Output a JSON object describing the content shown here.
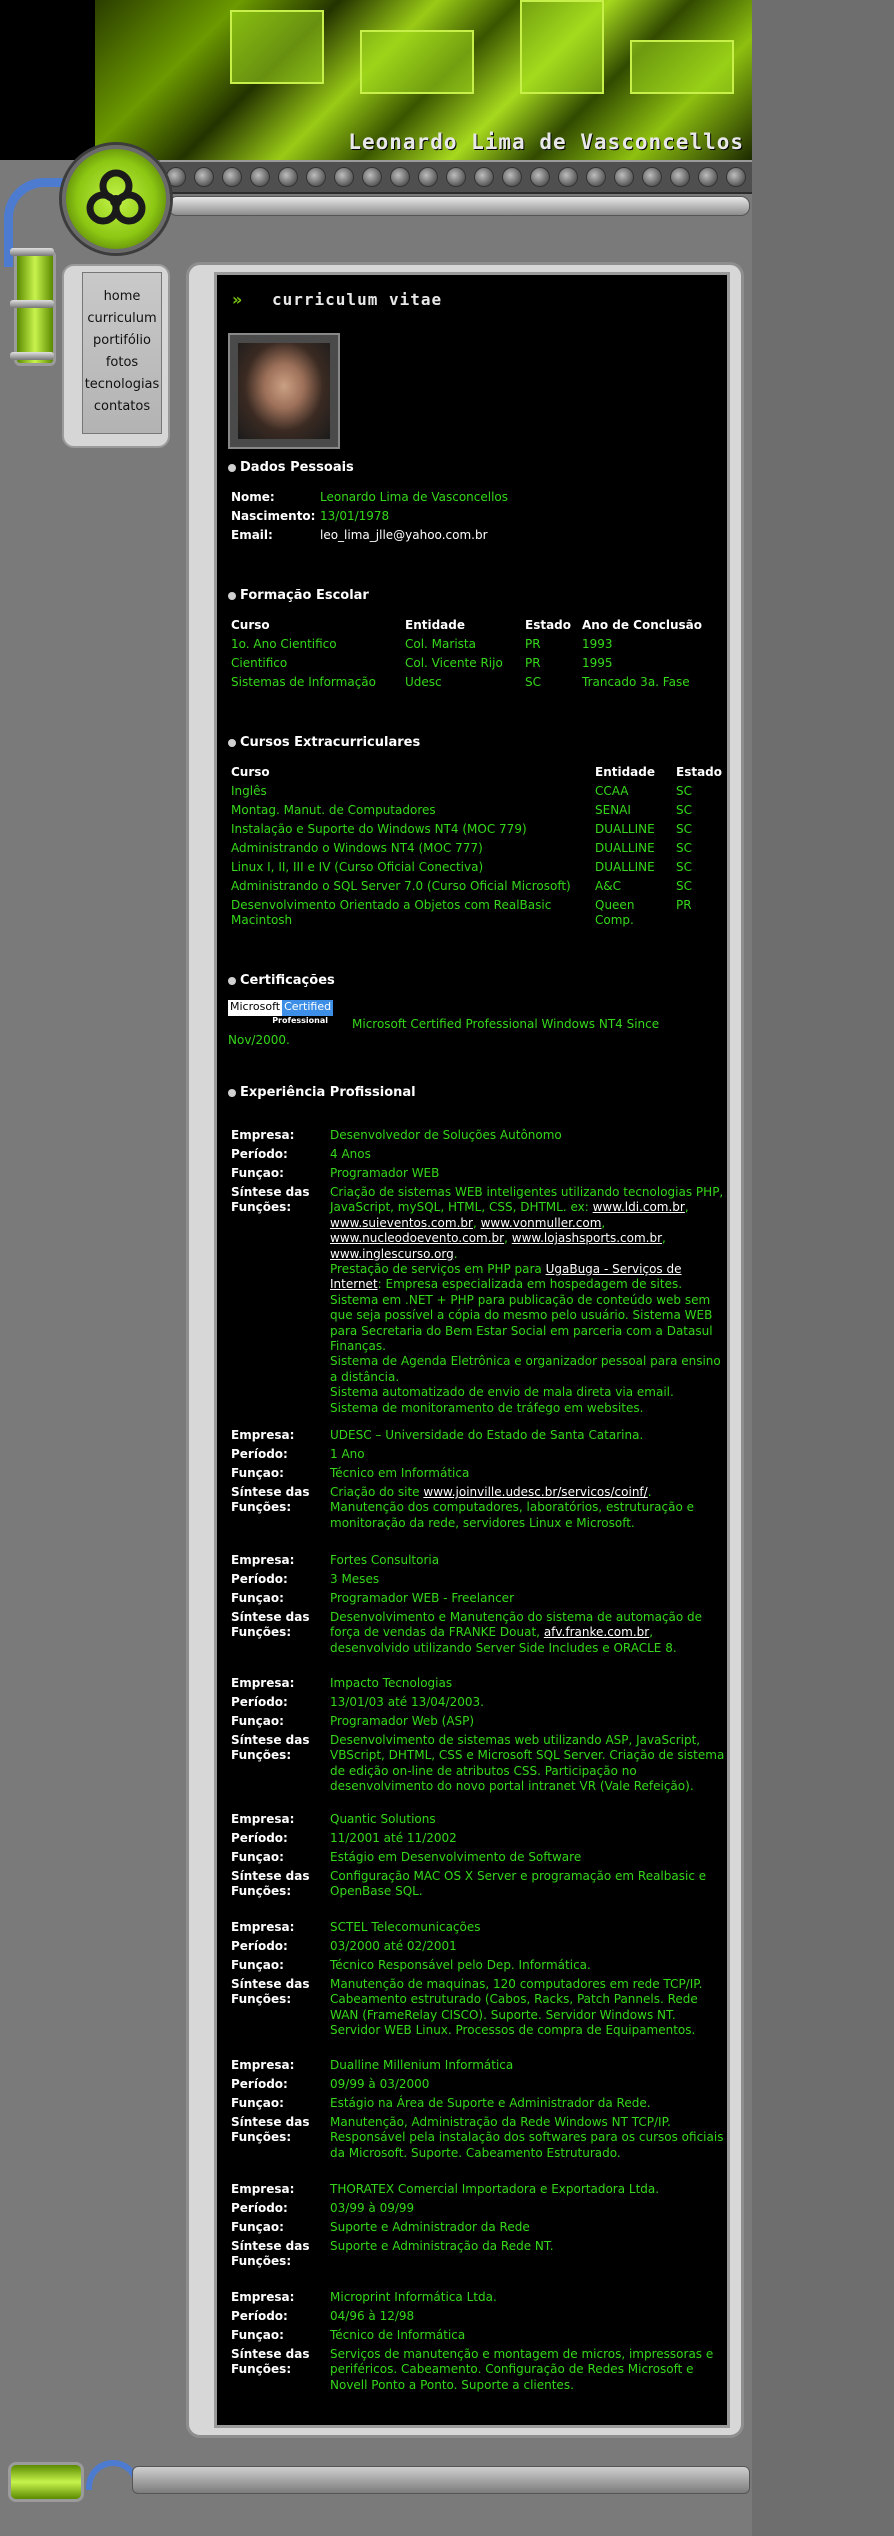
{
  "header": {
    "title": "Leonardo Lima de Vasconcellos"
  },
  "nav": [
    "home",
    "curriculum",
    "portifólio",
    "fotos",
    "tecnologias",
    "contatos"
  ],
  "cv_title": "curriculum vitae",
  "sections": {
    "dados": "Dados Pessoais",
    "formacao": "Formação Escolar",
    "cursos": "Cursos Extracurriculares",
    "certificacoes": "Certificações",
    "experiencia": "Experiência Profissional"
  },
  "personal": {
    "nome_label": "Nome:",
    "nome": "Leonardo Lima de Vasconcellos",
    "nasc_label": "Nascimento:",
    "nasc": "13/01/1978",
    "email_label": "Email:",
    "email": "leo_lima_jlle@yahoo.com.br"
  },
  "formacao": {
    "headers": [
      "Curso",
      "Entidade",
      "Estado",
      "Ano de Conclusão"
    ],
    "rows": [
      [
        "1o. Ano Cientifico",
        "Col. Marista",
        "PR",
        "1993"
      ],
      [
        "Cientifico",
        "Col. Vicente Rijo",
        "PR",
        "1995"
      ],
      [
        "Sistemas de Informação",
        "Udesc",
        "SC",
        "Trancado 3a. Fase"
      ]
    ]
  },
  "cursos": {
    "headers": [
      "Curso",
      "Entidade",
      "Estado"
    ],
    "rows": [
      [
        "Inglês",
        "CCAA",
        "SC"
      ],
      [
        "Montag. Manut. de Computadores",
        "SENAI",
        "SC"
      ],
      [
        "Instalação e Suporte do Windows NT4 (MOC 779)",
        "DUALLINE",
        "SC"
      ],
      [
        "Administrando o Windows NT4 (MOC 777)",
        "DUALLINE",
        "SC"
      ],
      [
        "Linux I, II, III e IV (Curso Oficial Conectiva)",
        "DUALLINE",
        "SC"
      ],
      [
        "Administrando o SQL Server 7.0 (Curso Oficial Microsoft)",
        "A&C",
        "SC"
      ],
      [
        "Desenvolvimento Orientado a Objetos com RealBasic Macintosh",
        "Queen Comp.",
        "PR"
      ]
    ]
  },
  "cert": {
    "logo_a": "Microsoft",
    "logo_b": "Certified",
    "logo_c": "Professional",
    "text": "Microsoft Certified Professional Windows NT4 Since Nov/2000."
  },
  "labels": {
    "empresa": "Empresa:",
    "periodo": "Período:",
    "funcao": "Funçao:",
    "sintese1": "Síntese das",
    "sintese2": "Funções:"
  },
  "jobs": [
    {
      "empresa": "Desenvolvedor de Soluções Autônomo",
      "periodo": "4 Anos",
      "funcao": "Programador WEB",
      "sintese": "Criação de sistemas WEB inteligentes utilizando tecnologias PHP, JavaScript, mySQL, HTML, CSS, DHTML. ex: <a>www.ldi.com.br</a>, <a>www.suieventos.com.br</a>, <a>www.vonmuller.com</a>, <a>www.nucleodoevento.com.br</a>, <a>www.lojashsports.com.br</a>, <a>www.inglescurso.org</a>.<br>Prestação de serviços em PHP para <a>UgaBuga - Serviços de Internet</a>: Empresa especializada em hospedagem de sites.<br>Sistema em .NET + PHP para publicação de conteúdo web sem que seja possível a cópia do mesmo pelo usuário. Sistema WEB para Secretaria do Bem Estar Social em parceria com a Datasul Finanças.<br>Sistema de Agenda Eletrônica e organizador pessoal para ensino a distância.<br>Sistema automatizado de envio de mala direta via email.<br>Sistema de monitoramento de tráfego em websites."
    },
    {
      "empresa": "UDESC – Universidade do Estado de Santa Catarina.",
      "periodo": "1 Ano",
      "funcao": "Técnico em Informática",
      "sintese": "Criação do site <a>www.joinville.udesc.br/servicos/coinf/</a>. Manutenção dos computadores, laboratórios, estruturação e monitoração da rede, servidores Linux e Microsoft."
    },
    {
      "empresa": "Fortes Consultoria",
      "periodo": "3 Meses",
      "funcao": "Programador WEB - Freelancer",
      "sintese": "Desenvolvimento e Manutenção do sistema de automação de força de vendas da FRANKE Douat, <a>afv.franke.com.br</a>, desenvolvido utilizando Server Side Includes e ORACLE 8."
    },
    {
      "empresa": "Impacto Tecnologias",
      "periodo": "13/01/03 até 13/04/2003.",
      "funcao": "Programador Web (ASP)",
      "sintese": "Desenvolvimento de sistemas web utilizando ASP, JavaScript, VBScript, DHTML, CSS e Microsoft SQL Server. Criação de sistema de edição on-line de atributos CSS. Participação no desenvolvimento do novo portal intranet VR (Vale Refeição)."
    },
    {
      "empresa": "Quantic Solutions",
      "periodo": "11/2001 até 11/2002",
      "funcao": "Estágio em Desenvolvimento de Software",
      "sintese": "Configuração MAC OS X Server e programação em Realbasic e OpenBase SQL."
    },
    {
      "empresa": "SCTEL Telecomunicações",
      "periodo": "03/2000 até 02/2001",
      "funcao": "Técnico Responsável pelo Dep. Informática.",
      "sintese": "Manutenção de maquinas, 120 computadores em rede TCP/IP. Cabeamento estruturado (Cabos, Racks, Patch Pannels. Rede WAN (FrameRelay CISCO). Suporte. Servidor Windows NT. Servidor WEB Linux. Processos de compra de Equipamentos."
    },
    {
      "empresa": "Dualline Millenium Informática",
      "periodo": "09/99 à 03/2000",
      "funcao": "Estágio na Área de Suporte e Administrador da Rede.",
      "sintese": "Manutenção, Administração da Rede Windows NT TCP/IP. Responsável pela instalação dos softwares para os cursos oficiais da Microsoft. Suporte. Cabeamento Estruturado."
    },
    {
      "empresa": "THORATEX Comercial Importadora e Exportadora Ltda.",
      "periodo": "03/99 à 09/99",
      "funcao": "Suporte e Administrador da Rede",
      "sintese": "Suporte e Administração da Rede NT."
    },
    {
      "empresa": "Microprint Informática Ltda.",
      "periodo": "04/96 à 12/98",
      "funcao": "Técnico de Informática",
      "sintese": "Serviços de manutenção e montagem de micros, impressoras e periféricos. Cabeamento. Configuração de Redes Microsoft e Novell Ponto a Ponto. Suporte a clientes."
    }
  ]
}
